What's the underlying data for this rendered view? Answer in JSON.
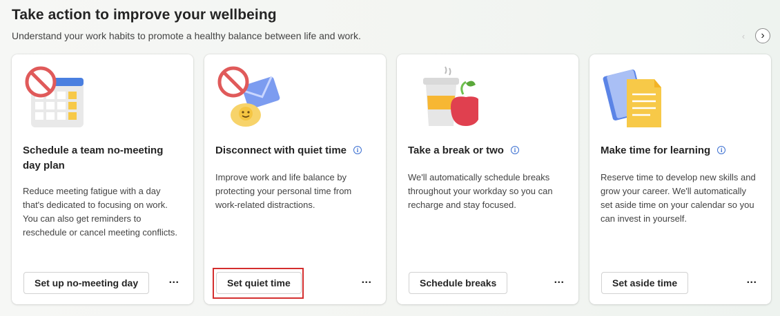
{
  "header": {
    "title": "Take action to improve your wellbeing",
    "subtitle": "Understand your work habits to promote a healthy balance between life and work."
  },
  "nav": {
    "prev_icon": "chevron-left-icon",
    "next_icon": "chevron-right-icon"
  },
  "cards": [
    {
      "title": "Schedule a team no-meeting day plan",
      "description": "Reduce meeting fatigue with a day that's dedicated to focusing on work. You can also get reminders to reschedule or cancel meeting conflicts.",
      "button": "Set up no-meeting day",
      "more": "...",
      "illustration": "calendar-no-icon"
    },
    {
      "title": "Disconnect with quiet time",
      "description": "Improve work and life balance by protecting your personal time from work-related distractions.",
      "button": "Set quiet time",
      "more": "...",
      "illustration": "mail-no-icon"
    },
    {
      "title": "Take a break or two",
      "description": "We'll automatically schedule breaks throughout your workday so you can recharge and stay focused.",
      "button": "Schedule breaks",
      "more": "...",
      "illustration": "coffee-apple-icon"
    },
    {
      "title": "Make time for learning",
      "description": "Reserve time to develop new skills and grow your career. We'll automatically set aside time on your calendar so you can invest in yourself.",
      "button": "Set aside time",
      "more": "...",
      "illustration": "notebook-icon"
    }
  ],
  "colors": {
    "highlight": "#d42e2e",
    "info": "#3b6fd1"
  }
}
